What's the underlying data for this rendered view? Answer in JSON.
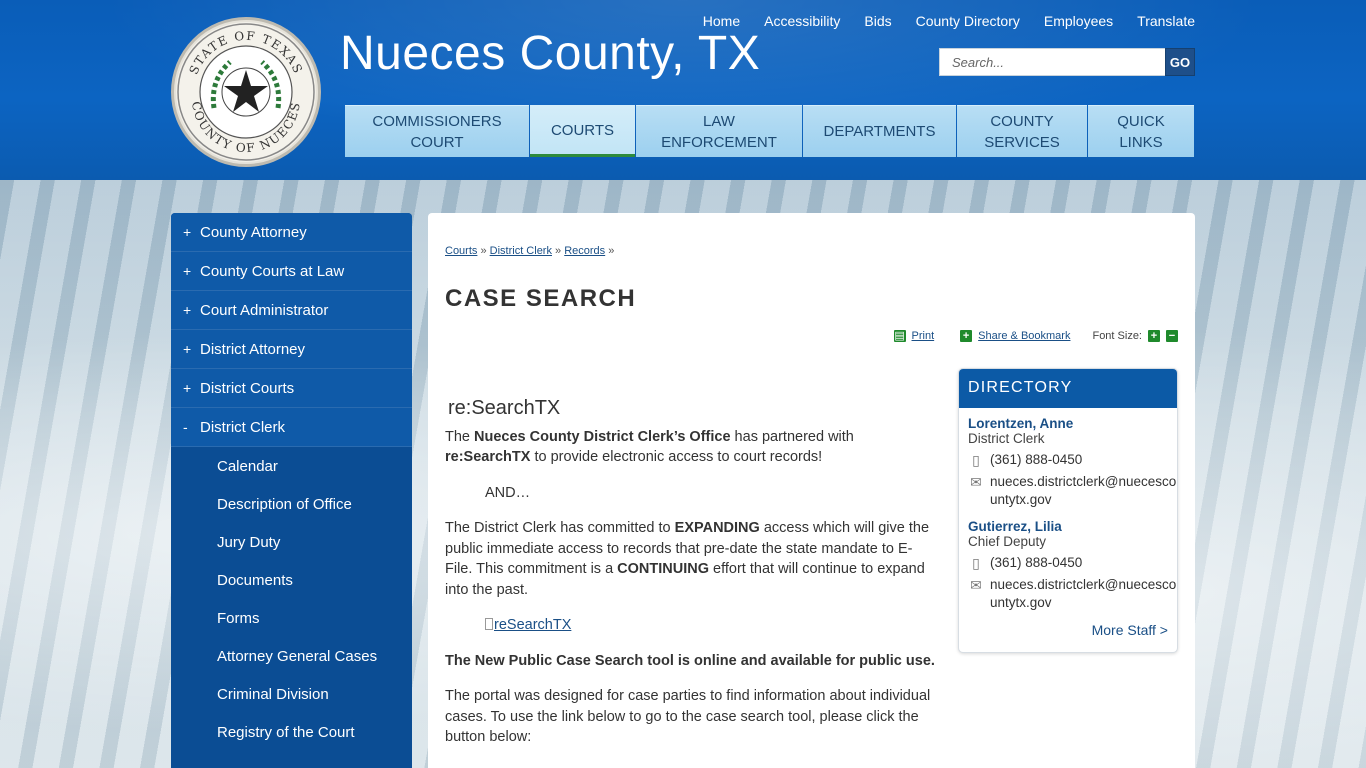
{
  "site": {
    "title": "Nueces County, TX",
    "seal_text_top": "STATE OF TEXAS",
    "seal_text_bottom": "COUNTY OF NUECES"
  },
  "util_nav": [
    "Home",
    "Accessibility",
    "Bids",
    "County Directory",
    "Employees",
    "Translate"
  ],
  "search": {
    "placeholder": "Search...",
    "go_label": "GO"
  },
  "main_nav": [
    {
      "label": "COMMISSIONERS COURT",
      "active": false
    },
    {
      "label": "COURTS",
      "active": true
    },
    {
      "label": "LAW ENFORCEMENT",
      "active": false
    },
    {
      "label": "DEPARTMENTS",
      "active": false
    },
    {
      "label": "COUNTY SERVICES",
      "active": false
    },
    {
      "label": "QUICK LINKS",
      "active": false
    }
  ],
  "sidebar": {
    "items": [
      {
        "label": "County Attorney",
        "marker": "+"
      },
      {
        "label": "County Courts at Law",
        "marker": "+"
      },
      {
        "label": "Court Administrator",
        "marker": "+"
      },
      {
        "label": "District Attorney",
        "marker": "+"
      },
      {
        "label": "District Courts",
        "marker": "+"
      },
      {
        "label": "District Clerk",
        "marker": "-"
      }
    ],
    "subitems": [
      "Calendar",
      "Description of Office",
      "Jury Duty",
      "Documents",
      "Forms",
      "Attorney General Cases",
      "Criminal Division",
      "Registry of the Court"
    ]
  },
  "breadcrumb": [
    "Courts",
    "District Clerk",
    "Records"
  ],
  "page_title": "CASE SEARCH",
  "tools": {
    "print": "Print",
    "share": "Share & Bookmark",
    "font_size": "Font Size:"
  },
  "article": {
    "heading": "re:SearchTX",
    "p1_a": "The ",
    "p1_b": "Nueces County District Clerk’s Office",
    "p1_c": " has partnered with ",
    "p1_d": "re:SearchTX",
    "p1_e": " to provide electronic access to court records!",
    "and": "AND…",
    "p2_a": "The District Clerk has committed to ",
    "p2_b": "EXPANDING",
    "p2_c": " access which will give the public immediate access to records that pre-date the state mandate to E-File. This commitment is a ",
    "p2_d": "CONTINUING",
    "p2_e": " effort that will continue to expand into the past.",
    "image_alt": "reSearchTX",
    "p3": "The New Public Case Search tool is online and available for public use.",
    "p4": "The portal was designed for case parties to find information about individual cases. To use the link below to go to the case search tool, please click the button below:"
  },
  "directory": {
    "title": "DIRECTORY",
    "people": [
      {
        "name": "Lorentzen, Anne",
        "role": "District Clerk",
        "phone": "(361) 888-0450",
        "email_1": "nueces.districtclerk@nuecesco",
        "email_2": "untytx.gov"
      },
      {
        "name": "Gutierrez, Lilia",
        "role": "Chief Deputy",
        "phone": "(361) 888-0450",
        "email_1": "nueces.districtclerk@nuecesco",
        "email_2": "untytx.gov"
      }
    ],
    "more": "More Staff >"
  },
  "colors": {
    "header_blue": "#0c64c2",
    "nav_light": "#9cd0ef",
    "sidebar_blue": "#0b4d94",
    "accent_green": "#2e8b3c"
  }
}
